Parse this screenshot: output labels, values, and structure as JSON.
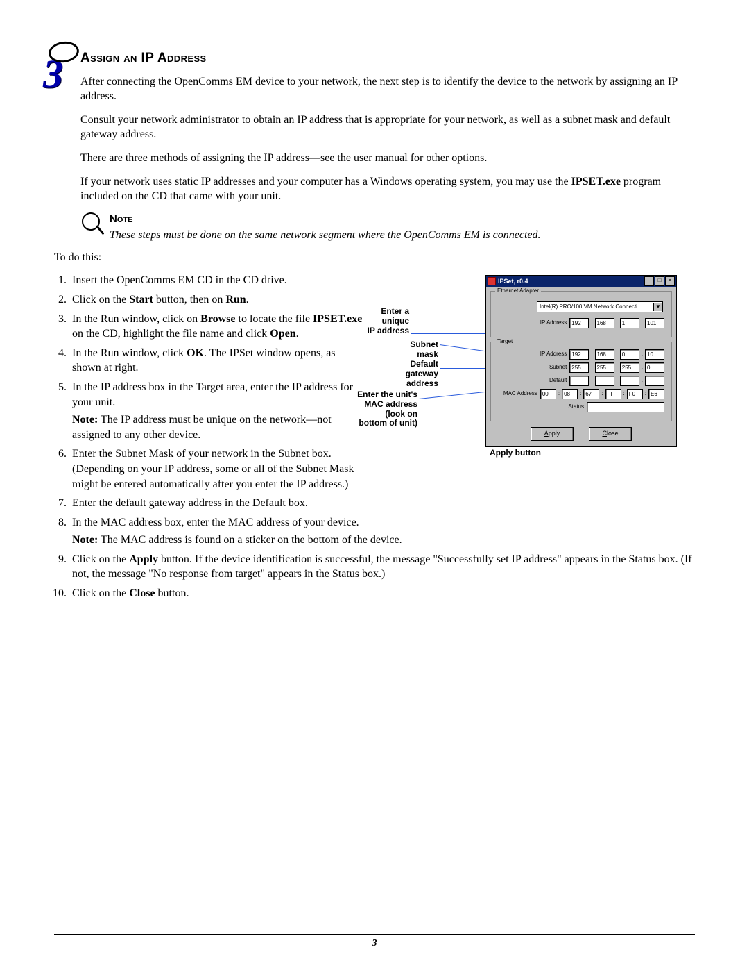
{
  "stepNumber": "3",
  "heading": "Assign an IP Address",
  "para1": "After connecting the OpenComms EM device to your network, the next step is to identify the device to the network by assigning an IP address.",
  "para2": "Consult your network administrator to obtain an IP address that is appropriate for your network, as well as a subnet mask and default gateway address.",
  "para3": "There are three methods of assigning the IP address—see the user manual for other options.",
  "para4a": "If your network uses static IP addresses and your computer has a Windows operating system, you may use the ",
  "para4b": "IPSET.exe",
  "para4c": " program included on the CD that came with your unit.",
  "note": {
    "title": "Note",
    "text": "These steps must be done on the same network segment where the OpenComms EM is connected."
  },
  "todo": "To do this:",
  "steps": {
    "s1": "Insert the OpenComms EM CD in the CD drive.",
    "s2a": "Click on the ",
    "s2b": "Start",
    "s2c": " button, then on ",
    "s2d": "Run",
    "s2e": ".",
    "s3a": "In the Run window, click on ",
    "s3b": "Browse",
    "s3c": " to locate the file ",
    "s3d": "IPSET.exe",
    "s3e": " on the CD, highlight the file name and click ",
    "s3f": "Open",
    "s3g": ".",
    "s4a": "In the Run window, click ",
    "s4b": "OK",
    "s4c": ". The IPSet window opens, as shown at right.",
    "s5": "In the IP address box in the Target area, enter the IP address for your unit.",
    "s5n1": "Note:",
    "s5n2": " The IP address must be unique on the network—not assigned to any other device.",
    "s6": "Enter the Subnet Mask of your network in the Subnet box. (Depending on your IP address, some or all of the Subnet Mask might be entered automatically after you enter the IP address.)",
    "s7": "Enter the default gateway address in the Default box.",
    "s8": "In the MAC address box, enter the MAC address of your device.",
    "s8n1": "Note:",
    "s8n2": " The MAC address is found on a sticker on the bottom of the device.",
    "s9a": "Click on the ",
    "s9b": "Apply",
    "s9c": " button. If the device identification is successful, the message \"Successfully set IP address\" appears in the Status box. (If not, the message \"No response from target\" appears in the Status box.)",
    "s10a": "Click on the ",
    "s10b": "Close",
    "s10c": " button."
  },
  "callouts": {
    "c1": "Enter a\nunique\nIP address",
    "c2": "Subnet\nmask",
    "c3": "Default\ngateway\naddress",
    "c4": "Enter the unit's\nMAC address\n(look on\nbottom of unit)",
    "c5": "Apply button"
  },
  "win": {
    "title": "IPSet, r0.4",
    "g1": "Ethernet Adapter",
    "g2": "Target",
    "adapter_dd": "Intel(R) PRO/100 VM Network Connecti",
    "lbl_ip": "IP Address",
    "lbl_sub": "Subnet",
    "lbl_def": "Default",
    "lbl_mac": "MAC Address",
    "lbl_status": "Status",
    "btn_apply": "Apply",
    "btn_close": "Close",
    "ip_adapter": [
      "192",
      "168",
      "1",
      "101"
    ],
    "ip_target": [
      "192",
      "168",
      "0",
      "10"
    ],
    "subnet": [
      "255",
      "255",
      "255",
      "0"
    ],
    "default": [
      "",
      "",
      "",
      ""
    ],
    "mac": [
      "00",
      "08",
      "67",
      "FF",
      "F0",
      "E6"
    ]
  },
  "pageNumber": "3"
}
